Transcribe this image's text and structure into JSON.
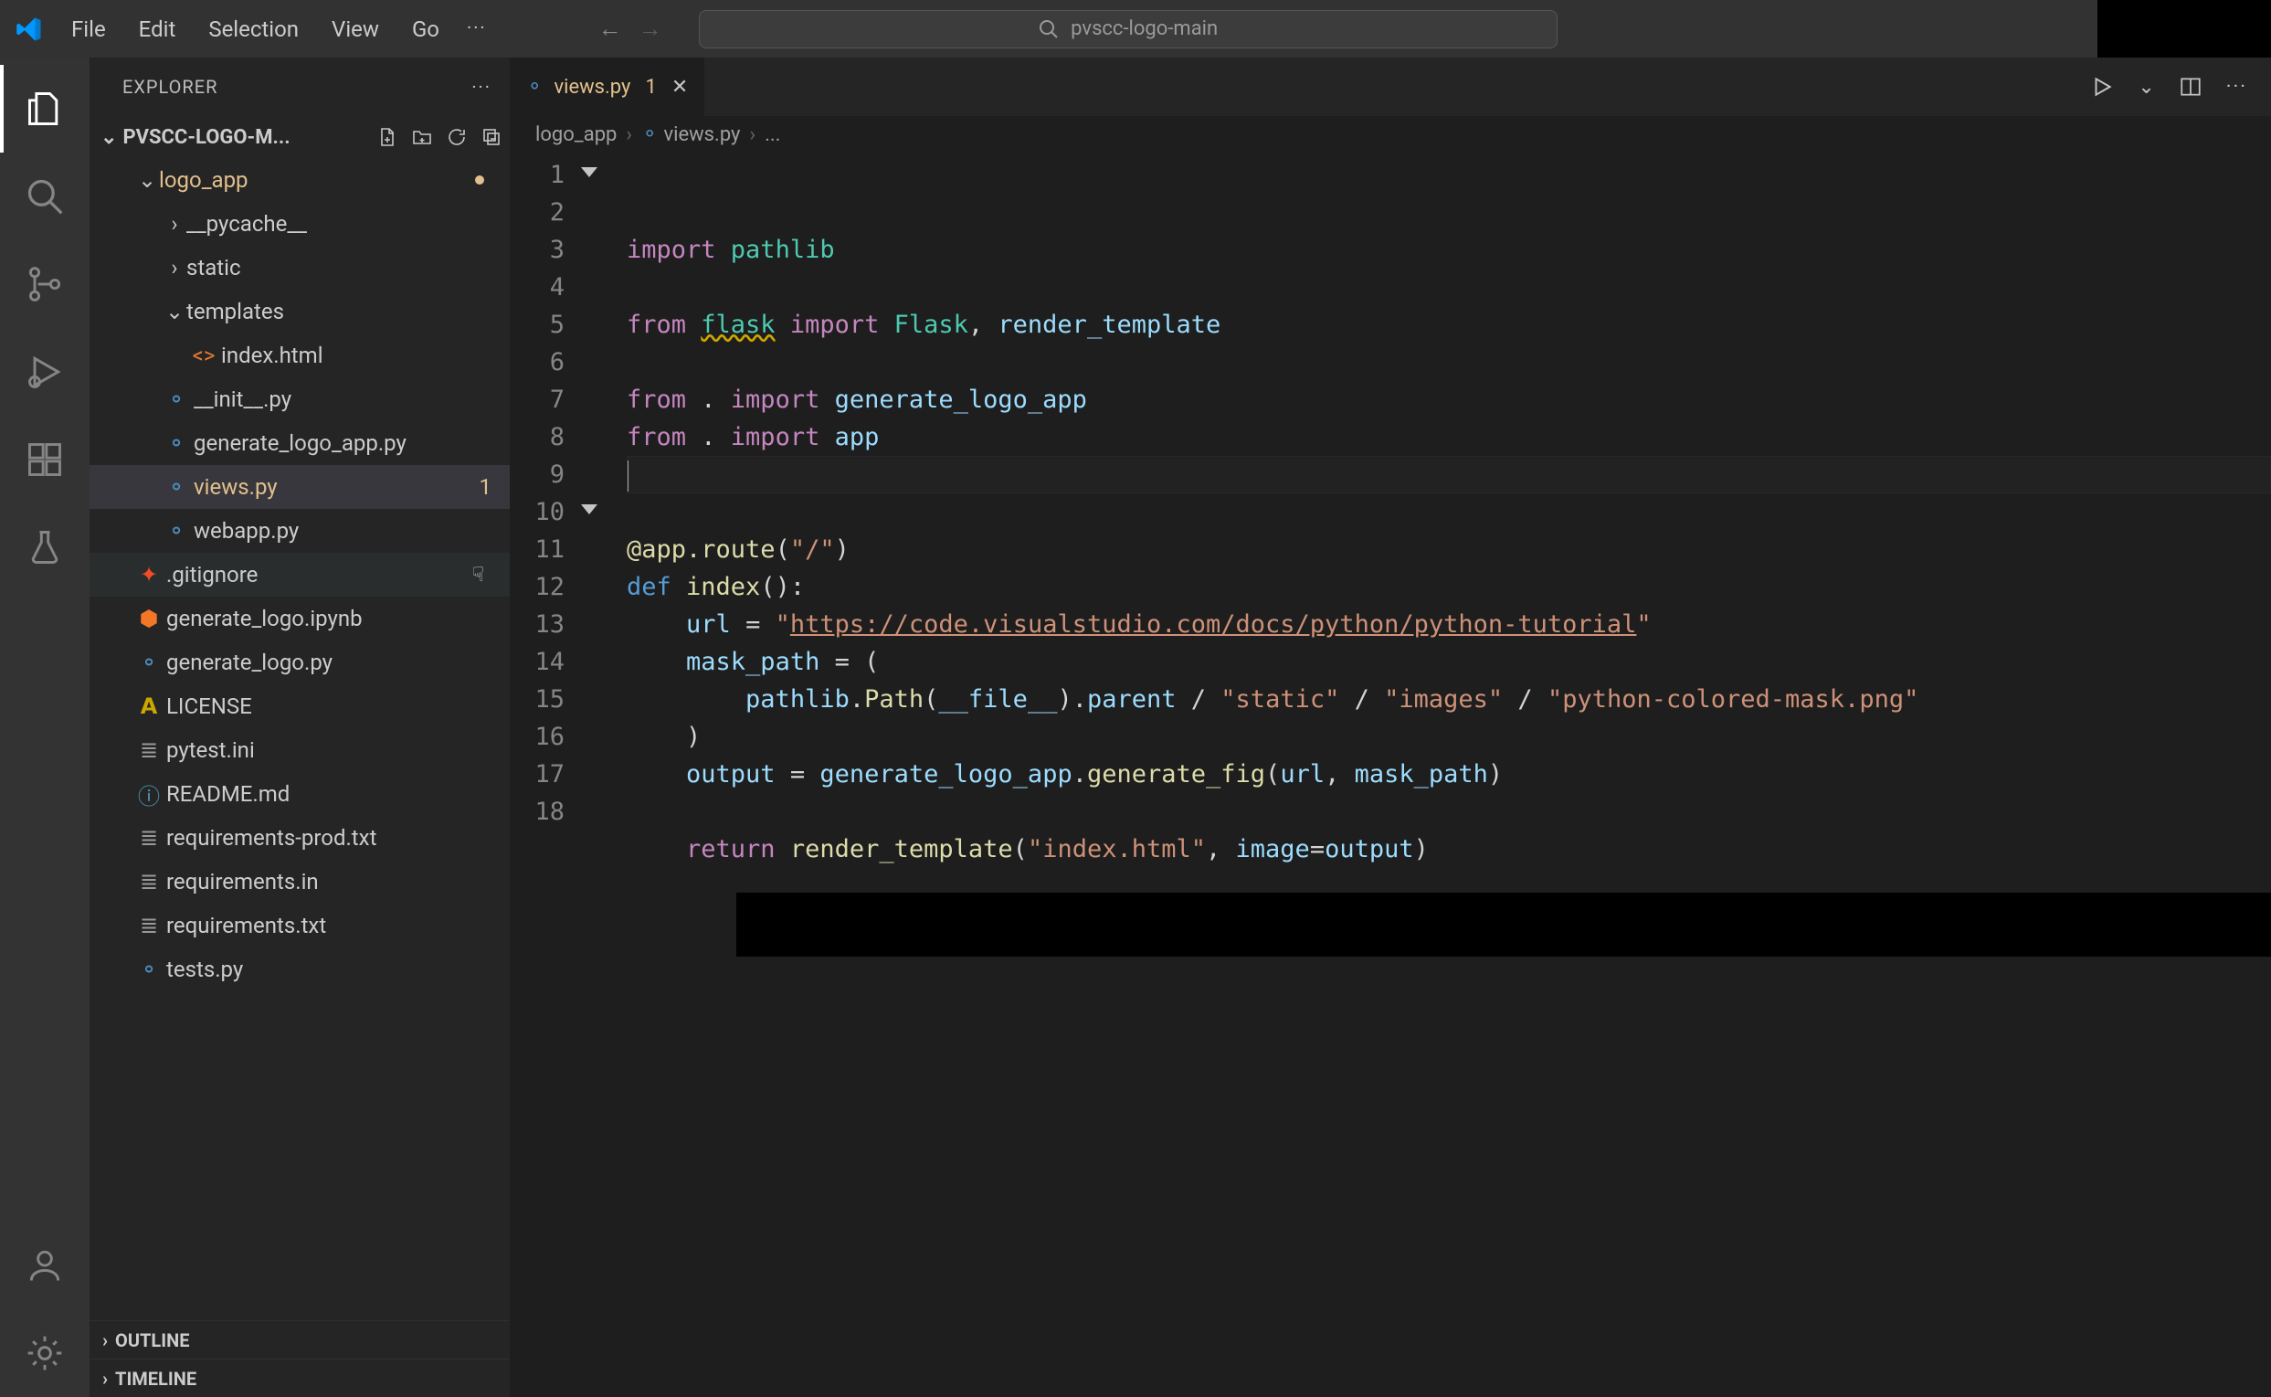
{
  "menu": {
    "items": [
      "File",
      "Edit",
      "Selection",
      "View",
      "Go"
    ],
    "more": "···"
  },
  "search_placeholder": "pvscc-logo-main",
  "sidebar": {
    "title": "EXPLORER",
    "root": "PVSCC-LOGO-M...",
    "outline": "OUTLINE",
    "timeline": "TIMELINE"
  },
  "file_tree": {
    "folder0": "logo_app",
    "folder0_items": [
      {
        "chev": ">",
        "label": "__pycache__",
        "type": "folder"
      },
      {
        "chev": ">",
        "label": "static",
        "type": "folder"
      },
      {
        "chev": "v",
        "label": "templates",
        "type": "folder-open"
      }
    ],
    "templates_items": [
      {
        "label": "index.html",
        "icon": "html"
      }
    ],
    "logo_files": [
      {
        "label": "__init__.py",
        "icon": "py"
      },
      {
        "label": "generate_logo_app.py",
        "icon": "py"
      },
      {
        "label": "views.py",
        "icon": "py",
        "selected": true,
        "badge": "1"
      },
      {
        "label": "webapp.py",
        "icon": "py"
      }
    ],
    "root_files": [
      {
        "label": ".gitignore",
        "icon": "git",
        "hover": true
      },
      {
        "label": "generate_logo.ipynb",
        "icon": "nb"
      },
      {
        "label": "generate_logo.py",
        "icon": "py"
      },
      {
        "label": "LICENSE",
        "icon": "lic"
      },
      {
        "label": "pytest.ini",
        "icon": "ini"
      },
      {
        "label": "README.md",
        "icon": "info"
      },
      {
        "label": "requirements-prod.txt",
        "icon": "txt"
      },
      {
        "label": "requirements.in",
        "icon": "txt"
      },
      {
        "label": "requirements.txt",
        "icon": "txt"
      },
      {
        "label": "tests.py",
        "icon": "py"
      }
    ]
  },
  "tabs": [
    {
      "label": "views.py",
      "badge": "1",
      "icon": "py",
      "modified": true
    }
  ],
  "breadcrumbs": [
    "logo_app",
    "views.py",
    "..."
  ],
  "code": {
    "line_count": 18,
    "lines_fold": [
      1,
      10
    ],
    "tokens": [
      [
        [
          "kw",
          "import "
        ],
        [
          "mod",
          "pathlib"
        ]
      ],
      [],
      [
        [
          "kw",
          "from "
        ],
        [
          "warn",
          "flask"
        ],
        [
          "kw",
          " import "
        ],
        [
          "mod",
          "Flask"
        ],
        [
          "op",
          ", "
        ],
        [
          "var",
          "render_template"
        ]
      ],
      [],
      [
        [
          "kw",
          "from "
        ],
        [
          "op",
          ". "
        ],
        [
          "kw",
          "import "
        ],
        [
          "var",
          "generate_logo_app"
        ]
      ],
      [
        [
          "kw",
          "from "
        ],
        [
          "op",
          ". "
        ],
        [
          "kw",
          "import "
        ],
        [
          "var",
          "app"
        ]
      ],
      [],
      [],
      [
        [
          "fn",
          "@app.route"
        ],
        [
          "op",
          "("
        ],
        [
          "str",
          "\"/\""
        ],
        [
          "op",
          ")"
        ]
      ],
      [
        [
          "def",
          "def "
        ],
        [
          "fn",
          "index"
        ],
        [
          "op",
          "():"
        ]
      ],
      [
        [
          "op",
          "    "
        ],
        [
          "var",
          "url"
        ],
        [
          "op",
          " = "
        ],
        [
          "str",
          "\""
        ],
        [
          "stru",
          "https://code.visualstudio.com/docs/python/python-tutorial"
        ],
        [
          "str",
          "\""
        ]
      ],
      [
        [
          "op",
          "    "
        ],
        [
          "var",
          "mask_path"
        ],
        [
          "op",
          " = ("
        ]
      ],
      [
        [
          "op",
          "        "
        ],
        [
          "var",
          "pathlib"
        ],
        [
          "op",
          "."
        ],
        [
          "fn",
          "Path"
        ],
        [
          "op",
          "("
        ],
        [
          "var",
          "__file__"
        ],
        [
          "op",
          ")."
        ],
        [
          "var",
          "parent"
        ],
        [
          "op",
          " / "
        ],
        [
          "str",
          "\"static\""
        ],
        [
          "op",
          " / "
        ],
        [
          "str",
          "\"images\""
        ],
        [
          "op",
          " / "
        ],
        [
          "str",
          "\"python-colored-mask.png\""
        ]
      ],
      [
        [
          "op",
          "    )"
        ]
      ],
      [
        [
          "op",
          "    "
        ],
        [
          "var",
          "output"
        ],
        [
          "op",
          " = "
        ],
        [
          "var",
          "generate_logo_app"
        ],
        [
          "op",
          "."
        ],
        [
          "fn",
          "generate_fig"
        ],
        [
          "op",
          "("
        ],
        [
          "var",
          "url"
        ],
        [
          "op",
          ", "
        ],
        [
          "var",
          "mask_path"
        ],
        [
          "op",
          ")"
        ]
      ],
      [],
      [
        [
          "op",
          "    "
        ],
        [
          "kw",
          "return "
        ],
        [
          "fn",
          "render_template"
        ],
        [
          "op",
          "("
        ],
        [
          "str",
          "\"index.html\""
        ],
        [
          "op",
          ", "
        ],
        [
          "var",
          "image"
        ],
        [
          "op",
          "="
        ],
        [
          "var",
          "output"
        ],
        [
          "op",
          ")"
        ]
      ],
      []
    ],
    "current_line": 7
  }
}
